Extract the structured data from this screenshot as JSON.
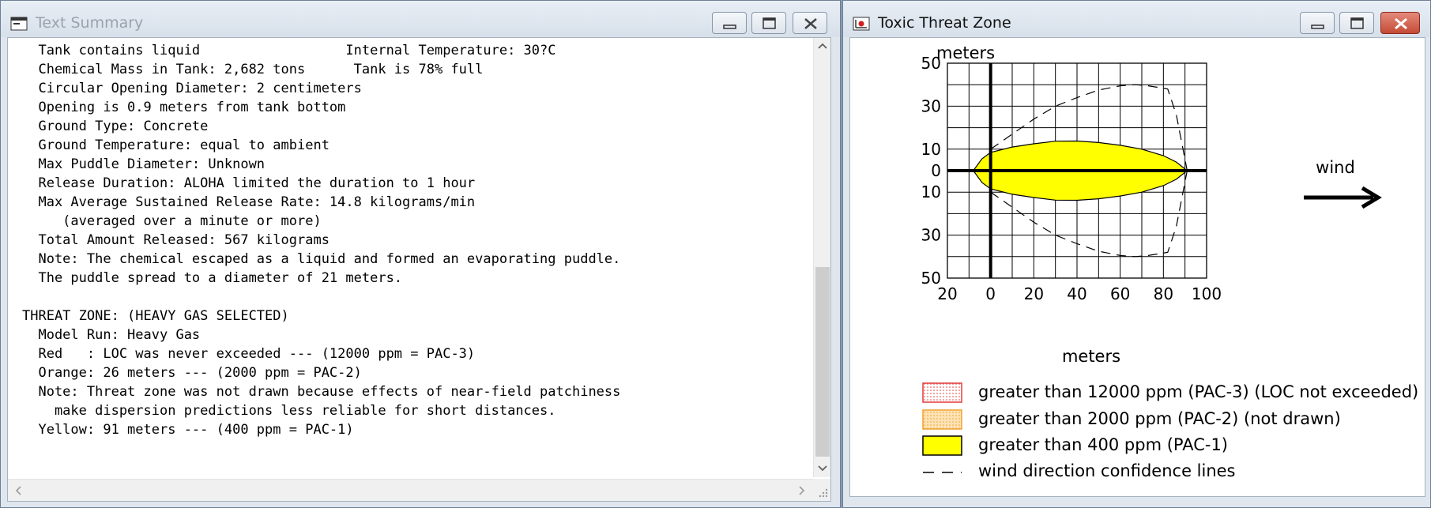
{
  "left_window": {
    "title": "Text Summary",
    "lines": [
      "  Tank contains liquid                  Internal Temperature: 30?C",
      "  Chemical Mass in Tank: 2,682 tons      Tank is 78% full",
      "  Circular Opening Diameter: 2 centimeters",
      "  Opening is 0.9 meters from tank bottom",
      "  Ground Type: Concrete",
      "  Ground Temperature: equal to ambient",
      "  Max Puddle Diameter: Unknown",
      "  Release Duration: ALOHA limited the duration to 1 hour",
      "  Max Average Sustained Release Rate: 14.8 kilograms/min",
      "     (averaged over a minute or more)",
      "  Total Amount Released: 567 kilograms",
      "  Note: The chemical escaped as a liquid and formed an evaporating puddle.",
      "  The puddle spread to a diameter of 21 meters.",
      "",
      "THREAT ZONE: (HEAVY GAS SELECTED)",
      "  Model Run: Heavy Gas",
      "  Red   : LOC was never exceeded --- (12000 ppm = PAC-3)",
      "  Orange: 26 meters --- (2000 ppm = PAC-2)",
      "  Note: Threat zone was not drawn because effects of near-field patchiness",
      "    make dispersion predictions less reliable for short distances.",
      "  Yellow: 91 meters --- (400 ppm = PAC-1)"
    ]
  },
  "right_window": {
    "title": "Toxic Threat Zone",
    "wind_label": "wind",
    "colors": {
      "yellow": "#ffff00",
      "orange_fill": "#fde3b5",
      "red_border": "#e23c3c",
      "grid": "#000000"
    },
    "legend": [
      {
        "label": "greater than 12000 ppm (PAC-3) (LOC not exceeded)",
        "swatch": "red-dotted"
      },
      {
        "label": "greater than 2000 ppm (PAC-2) (not drawn)",
        "swatch": "orange-dotted"
      },
      {
        "label": "greater than 400 ppm (PAC-1)",
        "swatch": "yellow-solid"
      },
      {
        "label": "wind direction confidence lines",
        "swatch": "dashed-line"
      }
    ]
  },
  "chart_data": {
    "type": "area",
    "xlabel": "meters",
    "ylabel": "meters",
    "xlim": [
      -20,
      100
    ],
    "ylim": [
      -50,
      50
    ],
    "x_ticks": [
      "20",
      "0",
      "20",
      "40",
      "60",
      "80",
      "100"
    ],
    "y_ticks": [
      "50",
      "30",
      "10",
      "0",
      "10",
      "30",
      "50"
    ],
    "x_tick_values": [
      -20,
      0,
      20,
      40,
      60,
      80,
      100
    ],
    "y_tick_values": [
      50,
      30,
      10,
      0,
      -10,
      -30,
      -50
    ],
    "grid": true,
    "yellow_zone": {
      "x": [
        -8,
        -4,
        0,
        10,
        20,
        30,
        40,
        50,
        60,
        70,
        80,
        86,
        91
      ],
      "y_upper": [
        0,
        5.5,
        8.5,
        11,
        12.5,
        13.7,
        13.8,
        13.1,
        11.8,
        10,
        7,
        4,
        0
      ]
    },
    "confidence_lines": {
      "x": [
        0,
        10,
        20,
        30,
        40,
        50,
        60,
        67,
        73,
        82,
        86,
        91
      ],
      "y_upper": [
        10,
        17,
        24,
        30,
        34,
        37.5,
        39.5,
        40,
        39.5,
        38,
        26,
        0
      ]
    }
  }
}
